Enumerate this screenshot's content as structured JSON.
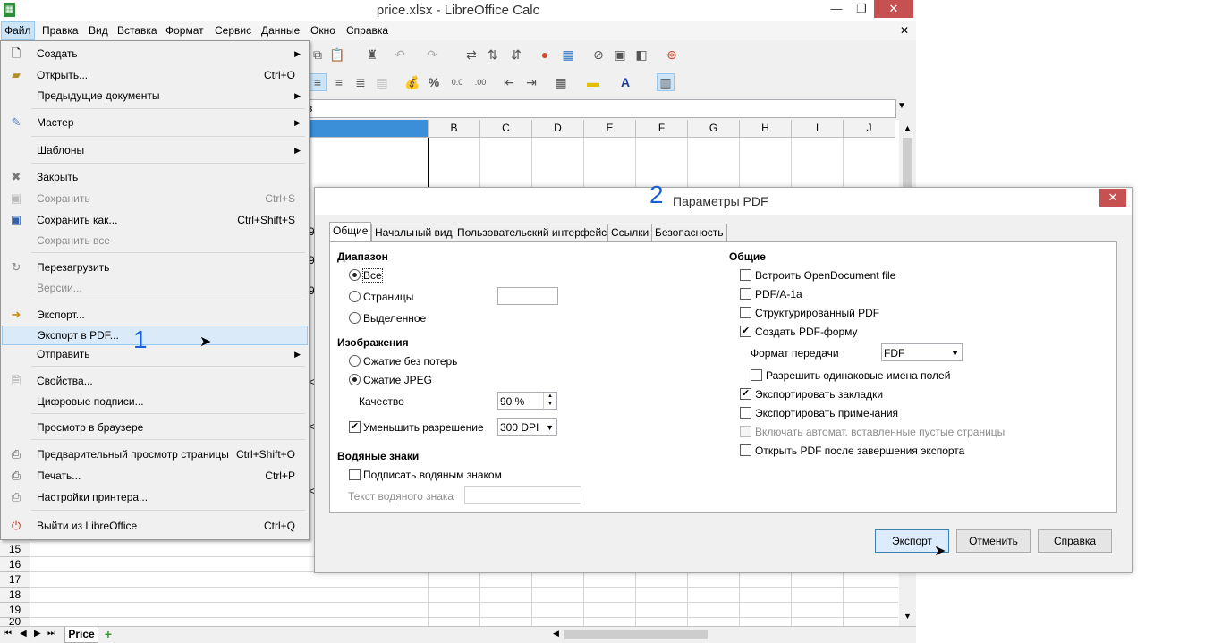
{
  "window": {
    "title": "price.xlsx - LibreOffice Calc",
    "minimize": "—",
    "restore": "❐",
    "close": "✕",
    "doc_close": "✕"
  },
  "menubar": [
    "Файл",
    "Правка",
    "Вид",
    "Вставка",
    "Формат",
    "Сервис",
    "Данные",
    "Окно",
    "Справка"
  ],
  "formula_bar": {
    "cell_text": "в"
  },
  "columns": [
    "B",
    "C",
    "D",
    "E",
    "F",
    "G",
    "H",
    "I",
    "J"
  ],
  "rows": [
    "15",
    "16",
    "17",
    "18",
    "19",
    "20"
  ],
  "partial_cells": [
    "9",
    "9",
    "9",
    "<",
    "<",
    "<",
    "<",
    "<",
    "<"
  ],
  "sheet_tab": "Price",
  "add_sheet": "+",
  "file_menu": {
    "items": [
      {
        "label": "Создать",
        "shortcut": "",
        "submenu": true,
        "disabled": false,
        "icon": "new-document-icon"
      },
      {
        "label": "Открыть...",
        "shortcut": "Ctrl+O",
        "submenu": false,
        "disabled": false,
        "icon": "folder-open-icon"
      },
      {
        "label": "Предыдущие документы",
        "shortcut": "",
        "submenu": true,
        "disabled": false,
        "icon": ""
      },
      {
        "label": "Мастер",
        "shortcut": "",
        "submenu": true,
        "disabled": false,
        "icon": "wizard-icon"
      },
      {
        "label": "Шаблоны",
        "shortcut": "",
        "submenu": true,
        "disabled": false,
        "icon": ""
      },
      {
        "label": "Закрыть",
        "shortcut": "",
        "submenu": false,
        "disabled": false,
        "icon": "close-icon"
      },
      {
        "label": "Сохранить",
        "shortcut": "Ctrl+S",
        "submenu": false,
        "disabled": true,
        "icon": "save-icon"
      },
      {
        "label": "Сохранить как...",
        "shortcut": "Ctrl+Shift+S",
        "submenu": false,
        "disabled": false,
        "icon": "save-as-icon"
      },
      {
        "label": "Сохранить все",
        "shortcut": "",
        "submenu": false,
        "disabled": true,
        "icon": ""
      },
      {
        "label": "Перезагрузить",
        "shortcut": "",
        "submenu": false,
        "disabled": false,
        "icon": "reload-icon"
      },
      {
        "label": "Версии...",
        "shortcut": "",
        "submenu": false,
        "disabled": true,
        "icon": ""
      },
      {
        "label": "Экспорт...",
        "shortcut": "",
        "submenu": false,
        "disabled": false,
        "icon": "export-icon"
      },
      {
        "label": "Экспорт в PDF...",
        "shortcut": "",
        "submenu": false,
        "disabled": false,
        "icon": ""
      },
      {
        "label": "Отправить",
        "shortcut": "",
        "submenu": true,
        "disabled": false,
        "icon": ""
      },
      {
        "label": "Свойства...",
        "shortcut": "",
        "submenu": false,
        "disabled": false,
        "icon": "properties-icon"
      },
      {
        "label": "Цифровые подписи...",
        "shortcut": "",
        "submenu": false,
        "disabled": false,
        "icon": ""
      },
      {
        "label": "Просмотр в браузере",
        "shortcut": "",
        "submenu": false,
        "disabled": false,
        "icon": ""
      },
      {
        "label": "Предварительный просмотр страницы",
        "shortcut": "Ctrl+Shift+O",
        "submenu": false,
        "disabled": false,
        "icon": "print-preview-icon"
      },
      {
        "label": "Печать...",
        "shortcut": "Ctrl+P",
        "submenu": false,
        "disabled": false,
        "icon": "printer-icon"
      },
      {
        "label": "Настройки принтера...",
        "shortcut": "",
        "submenu": false,
        "disabled": false,
        "icon": "printer-settings-icon"
      },
      {
        "label": "Выйти из LibreOffice",
        "shortcut": "Ctrl+Q",
        "submenu": false,
        "disabled": false,
        "icon": "exit-icon"
      }
    ],
    "step_label": "1"
  },
  "dialog": {
    "step_label": "2",
    "title": "Параметры PDF",
    "close": "✕",
    "tabs": [
      "Общие",
      "Начальный вид",
      "Пользовательский интерфейс",
      "Ссылки",
      "Безопасность"
    ],
    "range": {
      "header": "Диапазон",
      "all": "Все",
      "pages": "Страницы",
      "selection": "Выделенное",
      "pages_value": ""
    },
    "images": {
      "header": "Изображения",
      "lossless": "Сжатие без потерь",
      "jpeg": "Сжатие JPEG",
      "quality_label": "Качество",
      "quality_value": "90 %",
      "reduce_label": "Уменьшить разрешение",
      "reduce_value": "300 DPI"
    },
    "watermark": {
      "header": "Водяные знаки",
      "sign": "Подписать водяным знаком",
      "text_label": "Текст водяного знака",
      "text_value": ""
    },
    "general": {
      "header": "Общие",
      "embed_odf": "Встроить OpenDocument file",
      "pdfa": "PDF/A-1a",
      "tagged": "Структурированный PDF",
      "create_form": "Создать PDF-форму",
      "submit_format_label": "Формат передачи",
      "submit_format_value": "FDF",
      "allow_dup": "Разрешить одинаковые имена полей",
      "export_bookmarks": "Экспортировать закладки",
      "export_notes": "Экспортировать примечания",
      "auto_blank": "Включать автомат. вставленные пустые страницы",
      "open_after": "Открыть PDF после завершения экспорта"
    },
    "buttons": {
      "export": "Экспорт",
      "cancel": "Отменить",
      "help": "Справка"
    }
  },
  "colors": {
    "accent": "#1a5fd8",
    "close_red": "#c75050",
    "highlight": "#dbeaf9"
  }
}
